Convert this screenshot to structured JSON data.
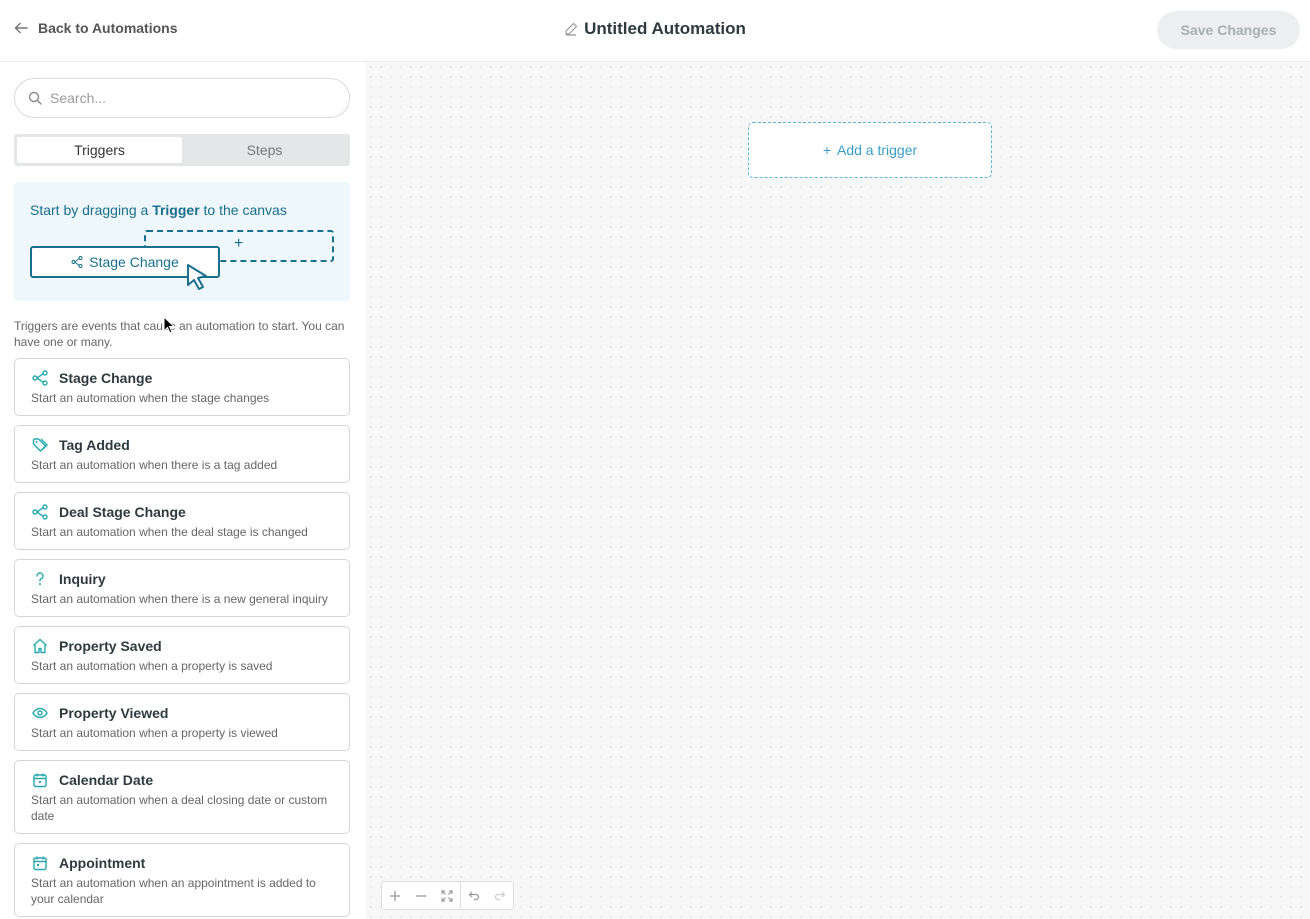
{
  "header": {
    "back_label": "Back to Automations",
    "title": "Untitled Automation",
    "save_label": "Save Changes"
  },
  "sidebar": {
    "search_placeholder": "Search...",
    "tabs": [
      {
        "label": "Triggers",
        "active": true
      },
      {
        "label": "Steps",
        "active": false
      }
    ],
    "hint": {
      "prefix": "Start by dragging a ",
      "bold": "Trigger",
      "suffix": " to the canvas",
      "demo_chip": "Stage Change"
    },
    "description": "Triggers are events that cause an automation to start. You can have one or many.",
    "triggers": [
      {
        "icon": "share-icon",
        "title": "Stage Change",
        "desc": "Start an automation when the stage changes"
      },
      {
        "icon": "tag-icon",
        "title": "Tag Added",
        "desc": "Start an automation when there is a tag added"
      },
      {
        "icon": "share-icon",
        "title": "Deal Stage Change",
        "desc": "Start an automation when the deal stage is changed"
      },
      {
        "icon": "question-icon",
        "title": "Inquiry",
        "desc": "Start an automation when there is a new general inquiry"
      },
      {
        "icon": "home-icon",
        "title": "Property Saved",
        "desc": "Start an automation when a property is saved"
      },
      {
        "icon": "eye-icon",
        "title": "Property Viewed",
        "desc": "Start an automation when a property is viewed"
      },
      {
        "icon": "calendar-icon",
        "title": "Calendar Date",
        "desc": "Start an automation when a deal closing date or custom date"
      },
      {
        "icon": "calendar-icon",
        "title": "Appointment",
        "desc": "Start an automation when an appointment is added to your calendar"
      }
    ]
  },
  "canvas": {
    "add_trigger_label": "Add a trigger"
  },
  "colors": {
    "accent": "#27a9b0",
    "hint_text": "#1a6f8c",
    "canvas_bg": "#f7f7f7"
  }
}
